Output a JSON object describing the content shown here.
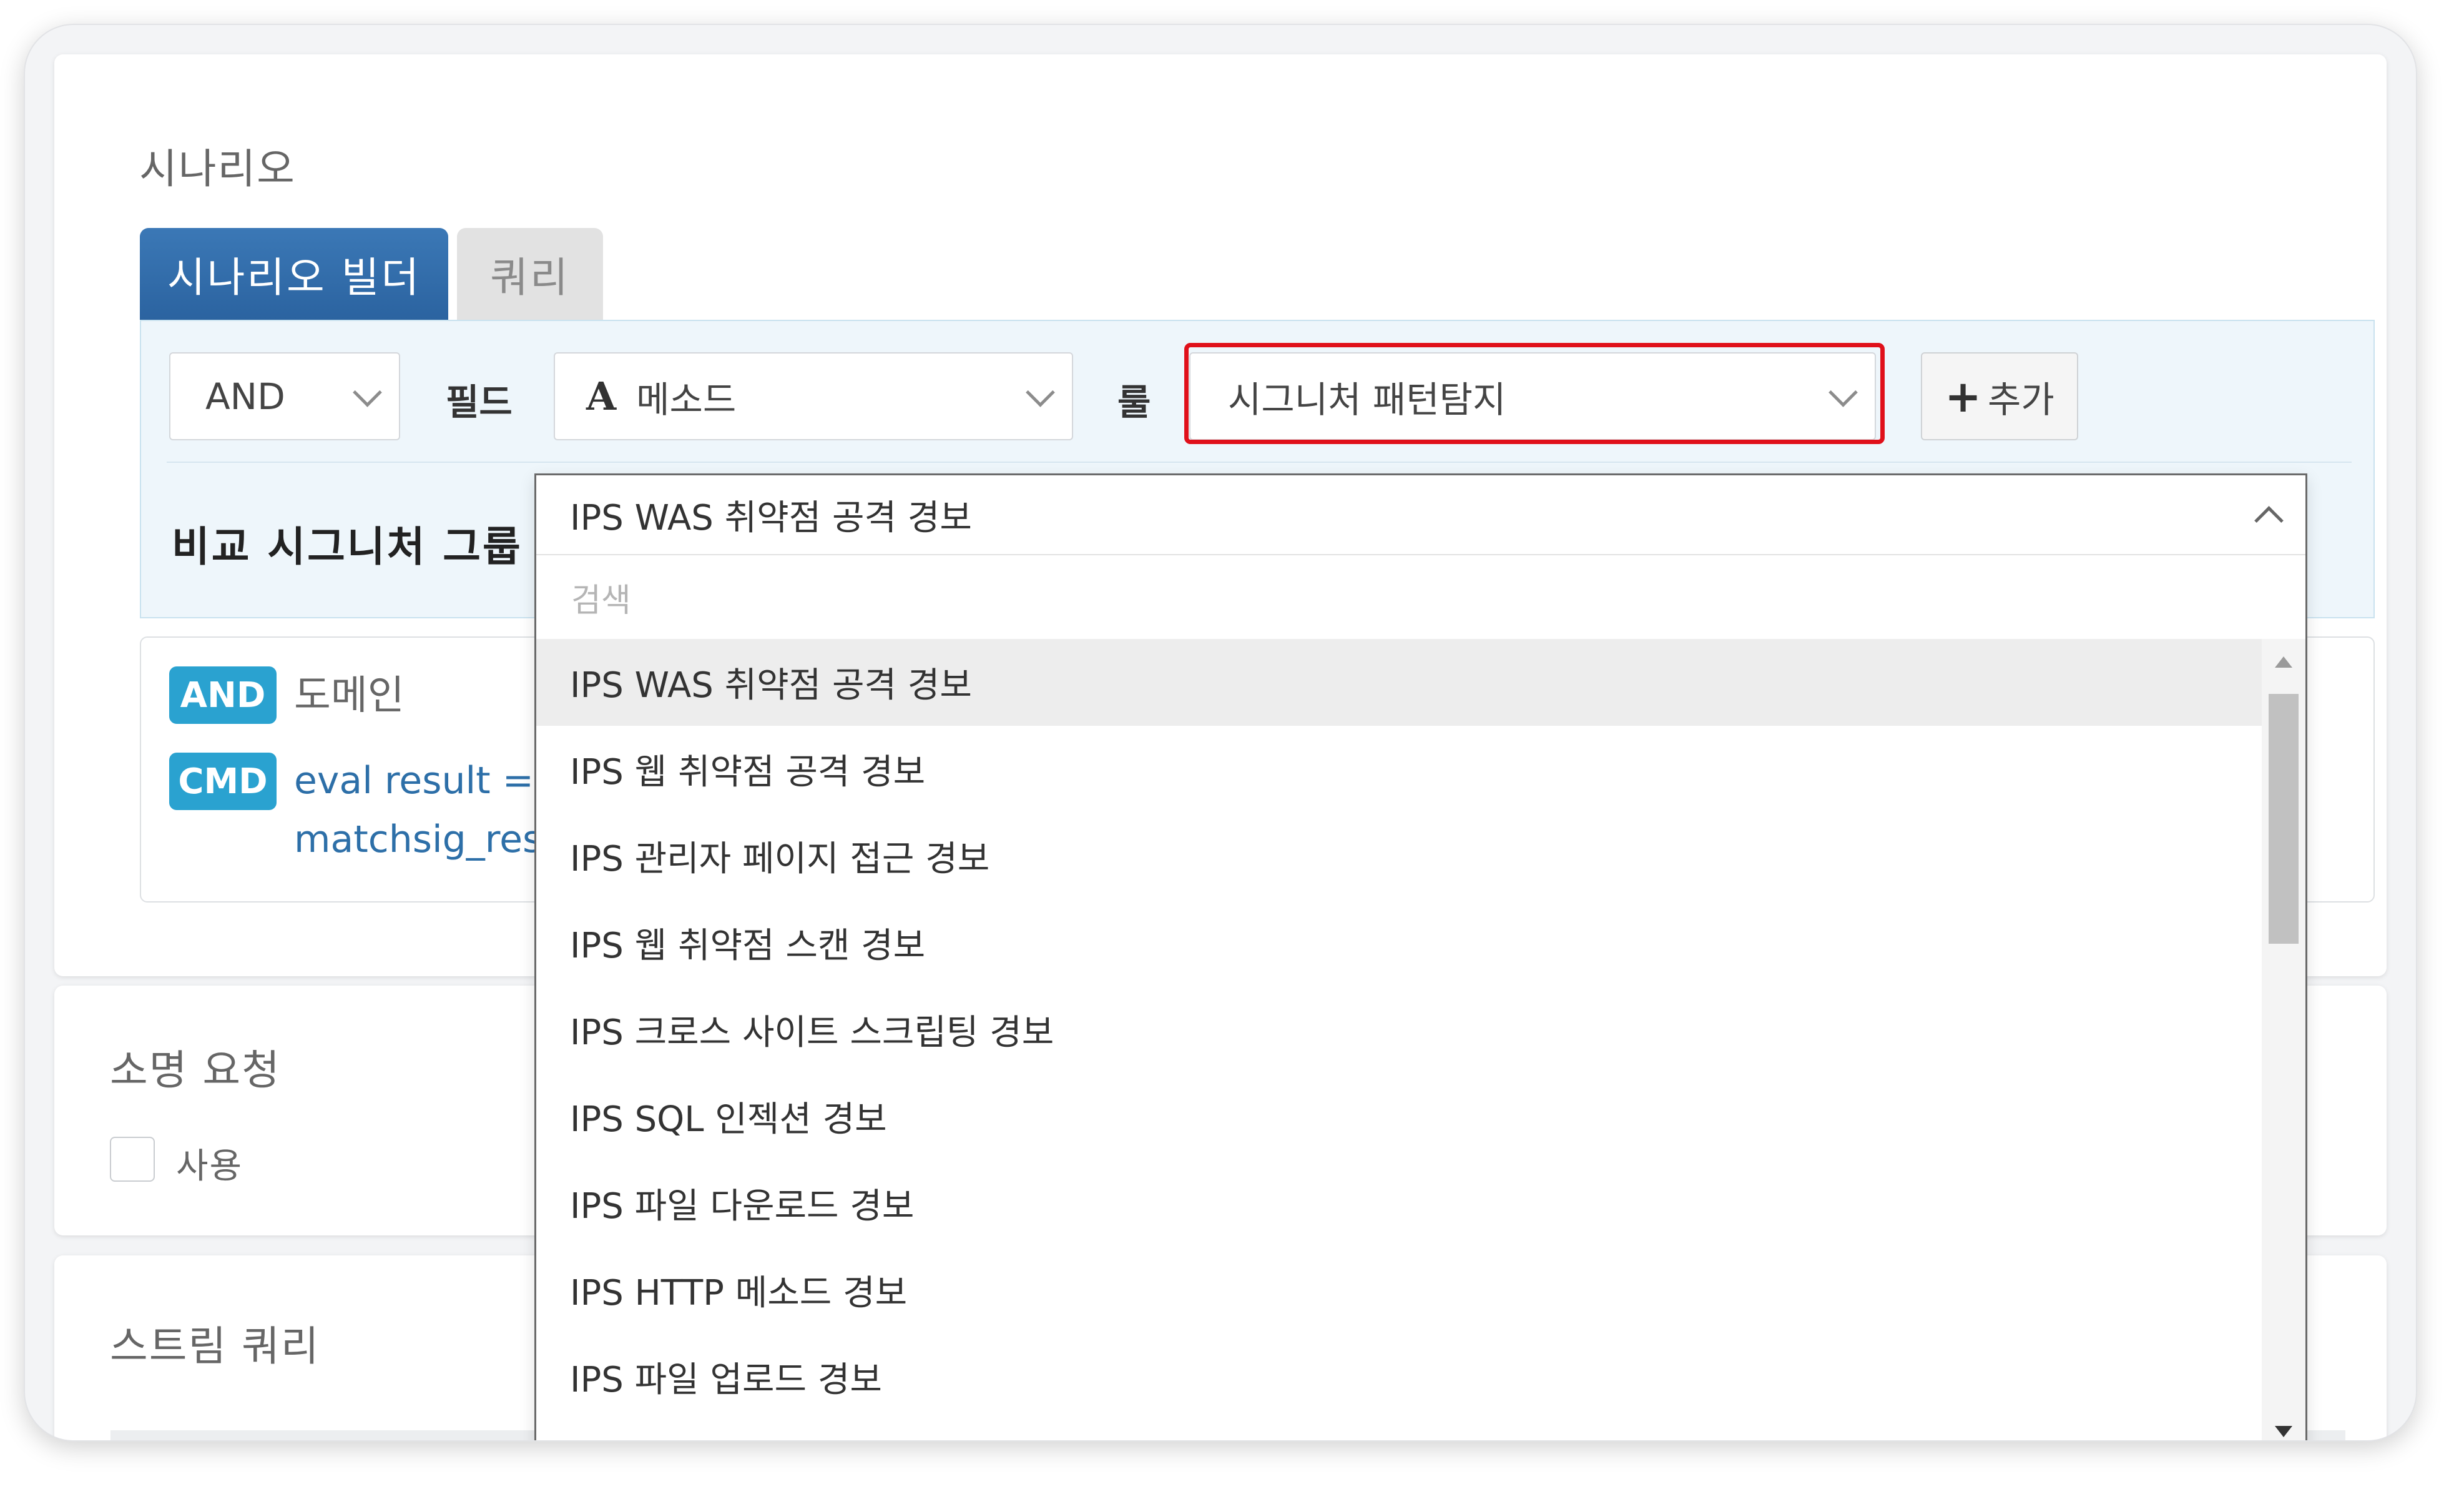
{
  "scenario": {
    "title": "시나리오",
    "tabs": [
      {
        "label": "시나리오 빌더",
        "active": true
      },
      {
        "label": "쿼리",
        "active": false
      }
    ],
    "builder": {
      "logic_select": "AND",
      "field_label": "필드",
      "field_icon": "A",
      "field_select": "메소드",
      "rule_label": "룰",
      "rule_select": "시그니처 패턴탐지",
      "add_button": "추가",
      "group_label": "비교 시그니처 그룹",
      "group_select": "IPS WAS 취약점 공격 경보"
    },
    "rules": {
      "logic_badge": "AND",
      "logic_text": "도메인",
      "cmd_badge": "CMD",
      "cmd_line1": "eval result = strj",
      "cmd_line2": "matchsig_result"
    }
  },
  "dropdown": {
    "search_placeholder": "검색",
    "options": [
      "IPS WAS 취약점 공격 경보",
      "IPS 웹 취약점 공격 경보",
      "IPS 관리자 페이지 접근 경보",
      "IPS 웹 취약점 스캔 경보",
      "IPS 크로스 사이트 스크립팅 경보",
      "IPS SQL 인젝션 경보",
      "IPS 파일 다운로드 경보",
      "IPS HTTP 메소드 경보",
      "IPS 파일 업로드 경보"
    ],
    "highlighted_index": 0
  },
  "summons": {
    "title": "소명 요청",
    "checkbox_label": "사용"
  },
  "stream_query": {
    "title": "스트림 쿼리"
  },
  "colors": {
    "primary_tab": "#2b63a0",
    "badge": "#2aa2d0",
    "highlight_border": "#e0101a"
  }
}
